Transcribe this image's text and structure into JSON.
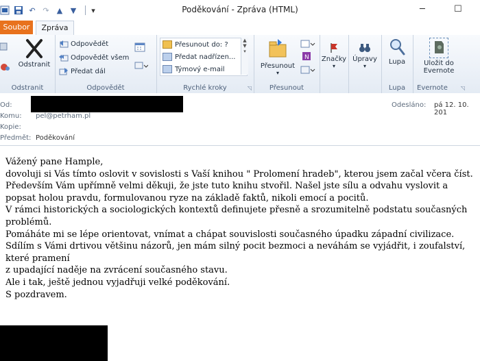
{
  "window": {
    "title": "Poděkování - Zpráva (HTML)"
  },
  "tabs": {
    "file": "Soubor",
    "message": "Zpráva"
  },
  "ribbon": {
    "odstranit": {
      "button": "Odstranit",
      "group": "Odstranit"
    },
    "odpovedet": {
      "reply": "Odpovědět",
      "reply_all": "Odpovědět všem",
      "forward": "Předat dál",
      "group": "Odpovědět"
    },
    "rychle_kroky": {
      "items": [
        "Přesunout do: ?",
        "Předat nadřízen...",
        "Týmový e-mail"
      ],
      "group": "Rychlé kroky"
    },
    "presunout": {
      "button": "Přesunout",
      "group": "Přesunout"
    },
    "znacky": {
      "label": "Značky"
    },
    "upravy": {
      "label": "Úpravy"
    },
    "lupa": {
      "button": "Lupa",
      "group": "Lupa"
    },
    "evernote": {
      "button_line1": "Uložit do",
      "button_line2": "Evernote",
      "group": "Evernote"
    }
  },
  "header": {
    "from_label": "Od:",
    "to_label": "Komu:",
    "to_value": "pel@petrham.pl",
    "cc_label": "Kopie:",
    "subject_label": "Předmět:",
    "subject_value": "Poděkování",
    "sent_label": "Odesláno:",
    "sent_value": "pá 12. 10. 201"
  },
  "message_body": [
    "Vážený pane Hample,",
    "dovoluji si Vás tímto oslovit v sovislosti s Vaší knihou \" Prolomení hradeb\", kterou jsem začal včera číst.",
    "Především Vám upřímně velmi děkuji, že jste tuto knihu stvořil. Našel jste sílu a odvahu vyslovit a popsat holou pravdu, formulovanou ryze na základě faktů, nikoli emocí a pocitů.",
    "V rámci historických a sociologických kontextů definujete přesně a srozumitelně podstatu současných problémů.",
    "Pomáháte mi se lépe orientovat, vnímat a chápat souvislosti současného úpadku západní civilizace.",
    "Sdílím s Vámi drtivou většinu názorů, jen mám silný pocit bezmoci a neváhám se vyjádřit, i zoufalství, které pramení",
    "z upadající naděje na zvrácení současného stavu.",
    "Ale i tak, ještě jednou vyjadřuji velké poděkování.",
    "S pozdravem."
  ],
  "colors": {
    "file_tab": "#e8721d",
    "ribbon_top": "#f8fafd",
    "ribbon_bottom": "#e4ebf4",
    "redaction": "#000000"
  }
}
